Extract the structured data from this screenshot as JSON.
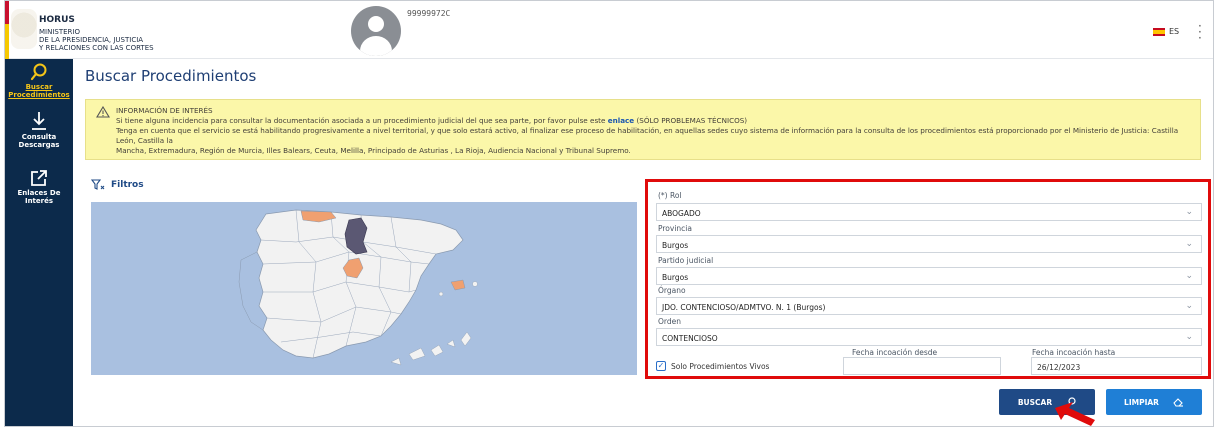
{
  "header": {
    "brand_name": "HORUS",
    "brand_line1": "MINISTERIO",
    "brand_line2": "DE LA PRESIDENCIA, JUSTICIA",
    "brand_line3": "Y RELACIONES CON LAS CORTES",
    "user_id": "99999972C",
    "language": "ES"
  },
  "sidebar": {
    "items": [
      {
        "label_line1": "Buscar",
        "label_line2": "Procedimientos",
        "icon": "search-icon",
        "active": true
      },
      {
        "label_line1": "Consulta",
        "label_line2": "Descargas",
        "icon": "download-icon",
        "active": false
      },
      {
        "label_line1": "Enlaces De Interés",
        "label_line2": "",
        "icon": "external-link-icon",
        "active": false
      }
    ]
  },
  "page": {
    "title": "Buscar Procedimientos"
  },
  "alert": {
    "heading": "INFORMACIÓN DE INTERÉS",
    "line1_pre": "Si tiene alguna incidencia para consultar la documentación asociada a un procedimiento judicial del que sea parte, por favor pulse este",
    "line1_link": "enlace",
    "line1_post": "(SÓLO PROBLEMAS TÉCNICOS)",
    "line2": "Tenga en cuenta que el servicio se está habilitando progresivamente a nivel territorial, y que solo estará activo, al finalizar ese proceso de habilitación, en aquellas sedes cuyo sistema de información para la consulta de los procedimientos está proporcionado por el Ministerio de Justicia: Castilla León, Castilla la",
    "line3": "Mancha, Extremadura, Región de Murcia, Illes Balears, Ceuta, Melilla, Principado de Asturias , La Rioja, Audiencia Nacional y Tribunal Supremo."
  },
  "filters": {
    "label": "Filtros"
  },
  "form": {
    "rol_label": "(*) Rol",
    "rol_value": "ABOGADO",
    "provincia_label": "Provincia",
    "provincia_value": "Burgos",
    "partido_label": "Partido judicial",
    "partido_value": "Burgos",
    "organo_label": "Órgano",
    "organo_value": "JDO. CONTENCIOSO/ADMTVO. N. 1 (Burgos)",
    "orden_label": "Orden",
    "orden_value": "CONTENCIOSO",
    "solo_vivos_label": "Solo Procedimientos Vivos",
    "solo_vivos_checked": true,
    "fecha_desde_label": "Fecha incoación desde",
    "fecha_desde_value": "",
    "fecha_hasta_label": "Fecha incoación hasta",
    "fecha_hasta_value": "26/12/2023"
  },
  "buttons": {
    "buscar": "BUSCAR",
    "limpiar": "LIMPIAR"
  },
  "colors": {
    "sidebar_bg": "#0c2a4b",
    "active_nav": "#f5c518",
    "alert_bg": "#fbf7a9",
    "highlight_border": "#e00b0b",
    "map_sea": "#a9c0e0",
    "map_selected_region": "#5b5873",
    "map_enabled_region": "#f0a070",
    "buscar_bg": "#1f4a86",
    "limpiar_bg": "#1f7fd6"
  }
}
